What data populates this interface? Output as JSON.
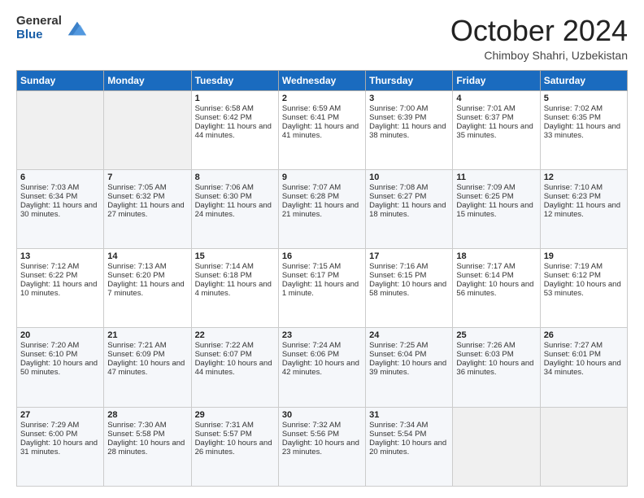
{
  "header": {
    "logo": {
      "line1": "General",
      "line2": "Blue"
    },
    "title": "October 2024",
    "subtitle": "Chimboy Shahri, Uzbekistan"
  },
  "days_of_week": [
    "Sunday",
    "Monday",
    "Tuesday",
    "Wednesday",
    "Thursday",
    "Friday",
    "Saturday"
  ],
  "weeks": [
    [
      {
        "day": "",
        "sunrise": "",
        "sunset": "",
        "daylight": ""
      },
      {
        "day": "",
        "sunrise": "",
        "sunset": "",
        "daylight": ""
      },
      {
        "day": "1",
        "sunrise": "Sunrise: 6:58 AM",
        "sunset": "Sunset: 6:42 PM",
        "daylight": "Daylight: 11 hours and 44 minutes."
      },
      {
        "day": "2",
        "sunrise": "Sunrise: 6:59 AM",
        "sunset": "Sunset: 6:41 PM",
        "daylight": "Daylight: 11 hours and 41 minutes."
      },
      {
        "day": "3",
        "sunrise": "Sunrise: 7:00 AM",
        "sunset": "Sunset: 6:39 PM",
        "daylight": "Daylight: 11 hours and 38 minutes."
      },
      {
        "day": "4",
        "sunrise": "Sunrise: 7:01 AM",
        "sunset": "Sunset: 6:37 PM",
        "daylight": "Daylight: 11 hours and 35 minutes."
      },
      {
        "day": "5",
        "sunrise": "Sunrise: 7:02 AM",
        "sunset": "Sunset: 6:35 PM",
        "daylight": "Daylight: 11 hours and 33 minutes."
      }
    ],
    [
      {
        "day": "6",
        "sunrise": "Sunrise: 7:03 AM",
        "sunset": "Sunset: 6:34 PM",
        "daylight": "Daylight: 11 hours and 30 minutes."
      },
      {
        "day": "7",
        "sunrise": "Sunrise: 7:05 AM",
        "sunset": "Sunset: 6:32 PM",
        "daylight": "Daylight: 11 hours and 27 minutes."
      },
      {
        "day": "8",
        "sunrise": "Sunrise: 7:06 AM",
        "sunset": "Sunset: 6:30 PM",
        "daylight": "Daylight: 11 hours and 24 minutes."
      },
      {
        "day": "9",
        "sunrise": "Sunrise: 7:07 AM",
        "sunset": "Sunset: 6:28 PM",
        "daylight": "Daylight: 11 hours and 21 minutes."
      },
      {
        "day": "10",
        "sunrise": "Sunrise: 7:08 AM",
        "sunset": "Sunset: 6:27 PM",
        "daylight": "Daylight: 11 hours and 18 minutes."
      },
      {
        "day": "11",
        "sunrise": "Sunrise: 7:09 AM",
        "sunset": "Sunset: 6:25 PM",
        "daylight": "Daylight: 11 hours and 15 minutes."
      },
      {
        "day": "12",
        "sunrise": "Sunrise: 7:10 AM",
        "sunset": "Sunset: 6:23 PM",
        "daylight": "Daylight: 11 hours and 12 minutes."
      }
    ],
    [
      {
        "day": "13",
        "sunrise": "Sunrise: 7:12 AM",
        "sunset": "Sunset: 6:22 PM",
        "daylight": "Daylight: 11 hours and 10 minutes."
      },
      {
        "day": "14",
        "sunrise": "Sunrise: 7:13 AM",
        "sunset": "Sunset: 6:20 PM",
        "daylight": "Daylight: 11 hours and 7 minutes."
      },
      {
        "day": "15",
        "sunrise": "Sunrise: 7:14 AM",
        "sunset": "Sunset: 6:18 PM",
        "daylight": "Daylight: 11 hours and 4 minutes."
      },
      {
        "day": "16",
        "sunrise": "Sunrise: 7:15 AM",
        "sunset": "Sunset: 6:17 PM",
        "daylight": "Daylight: 11 hours and 1 minute."
      },
      {
        "day": "17",
        "sunrise": "Sunrise: 7:16 AM",
        "sunset": "Sunset: 6:15 PM",
        "daylight": "Daylight: 10 hours and 58 minutes."
      },
      {
        "day": "18",
        "sunrise": "Sunrise: 7:17 AM",
        "sunset": "Sunset: 6:14 PM",
        "daylight": "Daylight: 10 hours and 56 minutes."
      },
      {
        "day": "19",
        "sunrise": "Sunrise: 7:19 AM",
        "sunset": "Sunset: 6:12 PM",
        "daylight": "Daylight: 10 hours and 53 minutes."
      }
    ],
    [
      {
        "day": "20",
        "sunrise": "Sunrise: 7:20 AM",
        "sunset": "Sunset: 6:10 PM",
        "daylight": "Daylight: 10 hours and 50 minutes."
      },
      {
        "day": "21",
        "sunrise": "Sunrise: 7:21 AM",
        "sunset": "Sunset: 6:09 PM",
        "daylight": "Daylight: 10 hours and 47 minutes."
      },
      {
        "day": "22",
        "sunrise": "Sunrise: 7:22 AM",
        "sunset": "Sunset: 6:07 PM",
        "daylight": "Daylight: 10 hours and 44 minutes."
      },
      {
        "day": "23",
        "sunrise": "Sunrise: 7:24 AM",
        "sunset": "Sunset: 6:06 PM",
        "daylight": "Daylight: 10 hours and 42 minutes."
      },
      {
        "day": "24",
        "sunrise": "Sunrise: 7:25 AM",
        "sunset": "Sunset: 6:04 PM",
        "daylight": "Daylight: 10 hours and 39 minutes."
      },
      {
        "day": "25",
        "sunrise": "Sunrise: 7:26 AM",
        "sunset": "Sunset: 6:03 PM",
        "daylight": "Daylight: 10 hours and 36 minutes."
      },
      {
        "day": "26",
        "sunrise": "Sunrise: 7:27 AM",
        "sunset": "Sunset: 6:01 PM",
        "daylight": "Daylight: 10 hours and 34 minutes."
      }
    ],
    [
      {
        "day": "27",
        "sunrise": "Sunrise: 7:29 AM",
        "sunset": "Sunset: 6:00 PM",
        "daylight": "Daylight: 10 hours and 31 minutes."
      },
      {
        "day": "28",
        "sunrise": "Sunrise: 7:30 AM",
        "sunset": "Sunset: 5:58 PM",
        "daylight": "Daylight: 10 hours and 28 minutes."
      },
      {
        "day": "29",
        "sunrise": "Sunrise: 7:31 AM",
        "sunset": "Sunset: 5:57 PM",
        "daylight": "Daylight: 10 hours and 26 minutes."
      },
      {
        "day": "30",
        "sunrise": "Sunrise: 7:32 AM",
        "sunset": "Sunset: 5:56 PM",
        "daylight": "Daylight: 10 hours and 23 minutes."
      },
      {
        "day": "31",
        "sunrise": "Sunrise: 7:34 AM",
        "sunset": "Sunset: 5:54 PM",
        "daylight": "Daylight: 10 hours and 20 minutes."
      },
      {
        "day": "",
        "sunrise": "",
        "sunset": "",
        "daylight": ""
      },
      {
        "day": "",
        "sunrise": "",
        "sunset": "",
        "daylight": ""
      }
    ]
  ]
}
